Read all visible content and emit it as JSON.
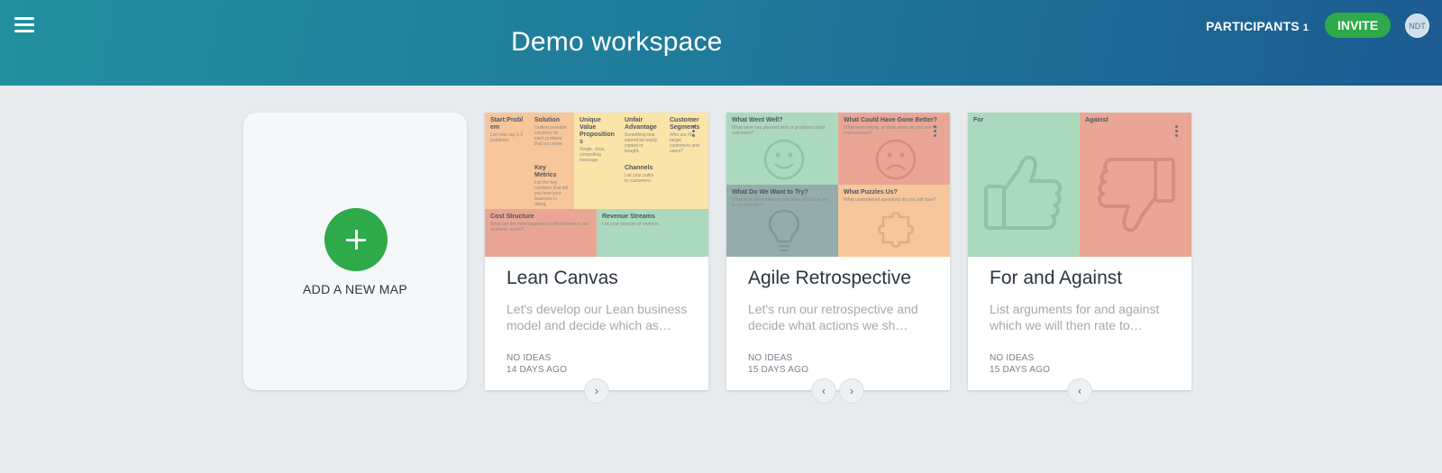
{
  "header": {
    "workspace_title": "Demo workspace",
    "participants_label": "PARTICIPANTS",
    "participants_count": "1",
    "invite_label": "INVITE",
    "avatar_initials": "NDT"
  },
  "add_map": {
    "label": "ADD A NEW MAP",
    "icon": "plus-icon"
  },
  "maps": [
    {
      "title": "Lean Canvas",
      "description": "Let's develop our Lean business model and decide which as…",
      "ideas": "NO IDEAS",
      "age": "14 DAYS AGO",
      "cells": [
        {
          "title": "Start:Probl em",
          "desc": "List your top 1-3 problems"
        },
        {
          "title": "Solution",
          "desc": "Outline possible solutions for each problem that you solve"
        },
        {
          "title": "Unique Value Proposition s",
          "desc": "Single, clear, compelling message."
        },
        {
          "title": "Unfair Advantage",
          "desc": "Something that cannot be easily copied or bought."
        },
        {
          "title": "Customer Segments",
          "desc": "Who are the target customers and users?"
        },
        {
          "title": "Key Metrics",
          "desc": "List the key numbers that tell you how your business is doing."
        },
        {
          "title": "Channels",
          "desc": "List your paths to customers."
        },
        {
          "title": "Cost Structure",
          "desc": "What are the most important costs inherent in our business model?"
        },
        {
          "title": "Revenue Streams",
          "desc": "List your sources of revenue."
        }
      ]
    },
    {
      "title": "Agile Retrospective",
      "description": "Let's run our retrospective and decide what actions we sh…",
      "ideas": "NO IDEAS",
      "age": "15 DAYS AGO",
      "cells": [
        {
          "title": "What Went Well?",
          "desc": "What were you pleased with or produced good outcomes?"
        },
        {
          "title": "What Could Have Gone Better?",
          "desc": "What went wrong, or what areas do you see for improvement?"
        },
        {
          "title": "What Do We Want to Try?",
          "desc": "What innovative ideas or practices would we like to try next time?"
        },
        {
          "title": "What Puzzles Us?",
          "desc": "What unanswered questions do you still have?"
        }
      ]
    },
    {
      "title": "For and Against",
      "description": "List arguments for and against which we will then rate to…",
      "ideas": "NO IDEAS",
      "age": "15 DAYS AGO",
      "cells": [
        {
          "title": "For",
          "desc": ""
        },
        {
          "title": "Against",
          "desc": ""
        }
      ]
    }
  ],
  "colors": {
    "accent_green": "#2eaa4a",
    "header_start": "#22909f",
    "header_end": "#1c5b91",
    "thumb_orange": "#f7c69a",
    "thumb_yellow": "#fbe4a8",
    "thumb_red": "#eaa694",
    "thumb_green": "#abd9bd",
    "thumb_teal": "#94adac"
  },
  "nav_icons": [
    "chevron-right-icon",
    "chevron-left-icon"
  ]
}
